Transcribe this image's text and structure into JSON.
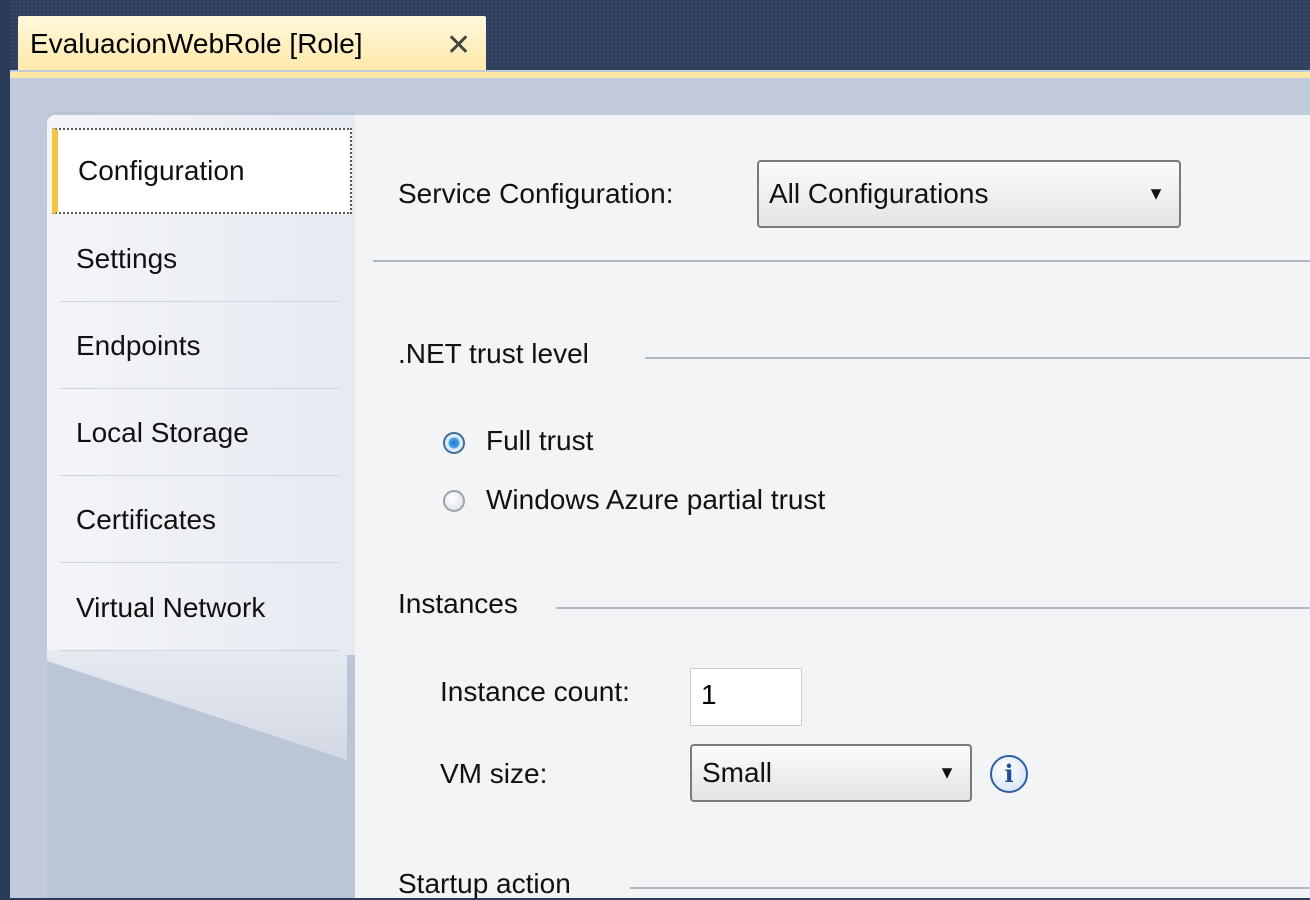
{
  "document_tab": {
    "title": "EvaluacionWebRole [Role]",
    "close_icon": "close-icon",
    "close_glyph": "✕"
  },
  "sidebar": {
    "tabs": [
      {
        "label": "Configuration",
        "active": true
      },
      {
        "label": "Settings",
        "active": false
      },
      {
        "label": "Endpoints",
        "active": false
      },
      {
        "label": "Local Storage",
        "active": false
      },
      {
        "label": "Certificates",
        "active": false
      },
      {
        "label": "Virtual Network",
        "active": false
      }
    ]
  },
  "service_configuration": {
    "label": "Service Configuration:",
    "value": "All Configurations",
    "arrow": "▼"
  },
  "trust": {
    "heading": ".NET trust level",
    "options": [
      {
        "label": "Full trust",
        "checked": true
      },
      {
        "label": "Windows Azure partial trust",
        "checked": false
      }
    ]
  },
  "instances": {
    "heading": "Instances",
    "count_label": "Instance count:",
    "count_value": "1",
    "vm_size_label": "VM size:",
    "vm_size_value": "Small",
    "arrow": "▼",
    "info_icon": "info-icon",
    "info_glyph": "i"
  },
  "startup": {
    "heading": "Startup action"
  },
  "colors": {
    "tab_accent": "#f5c542",
    "radio_selected": "#1e78c8",
    "frame": "#2b3b58"
  }
}
